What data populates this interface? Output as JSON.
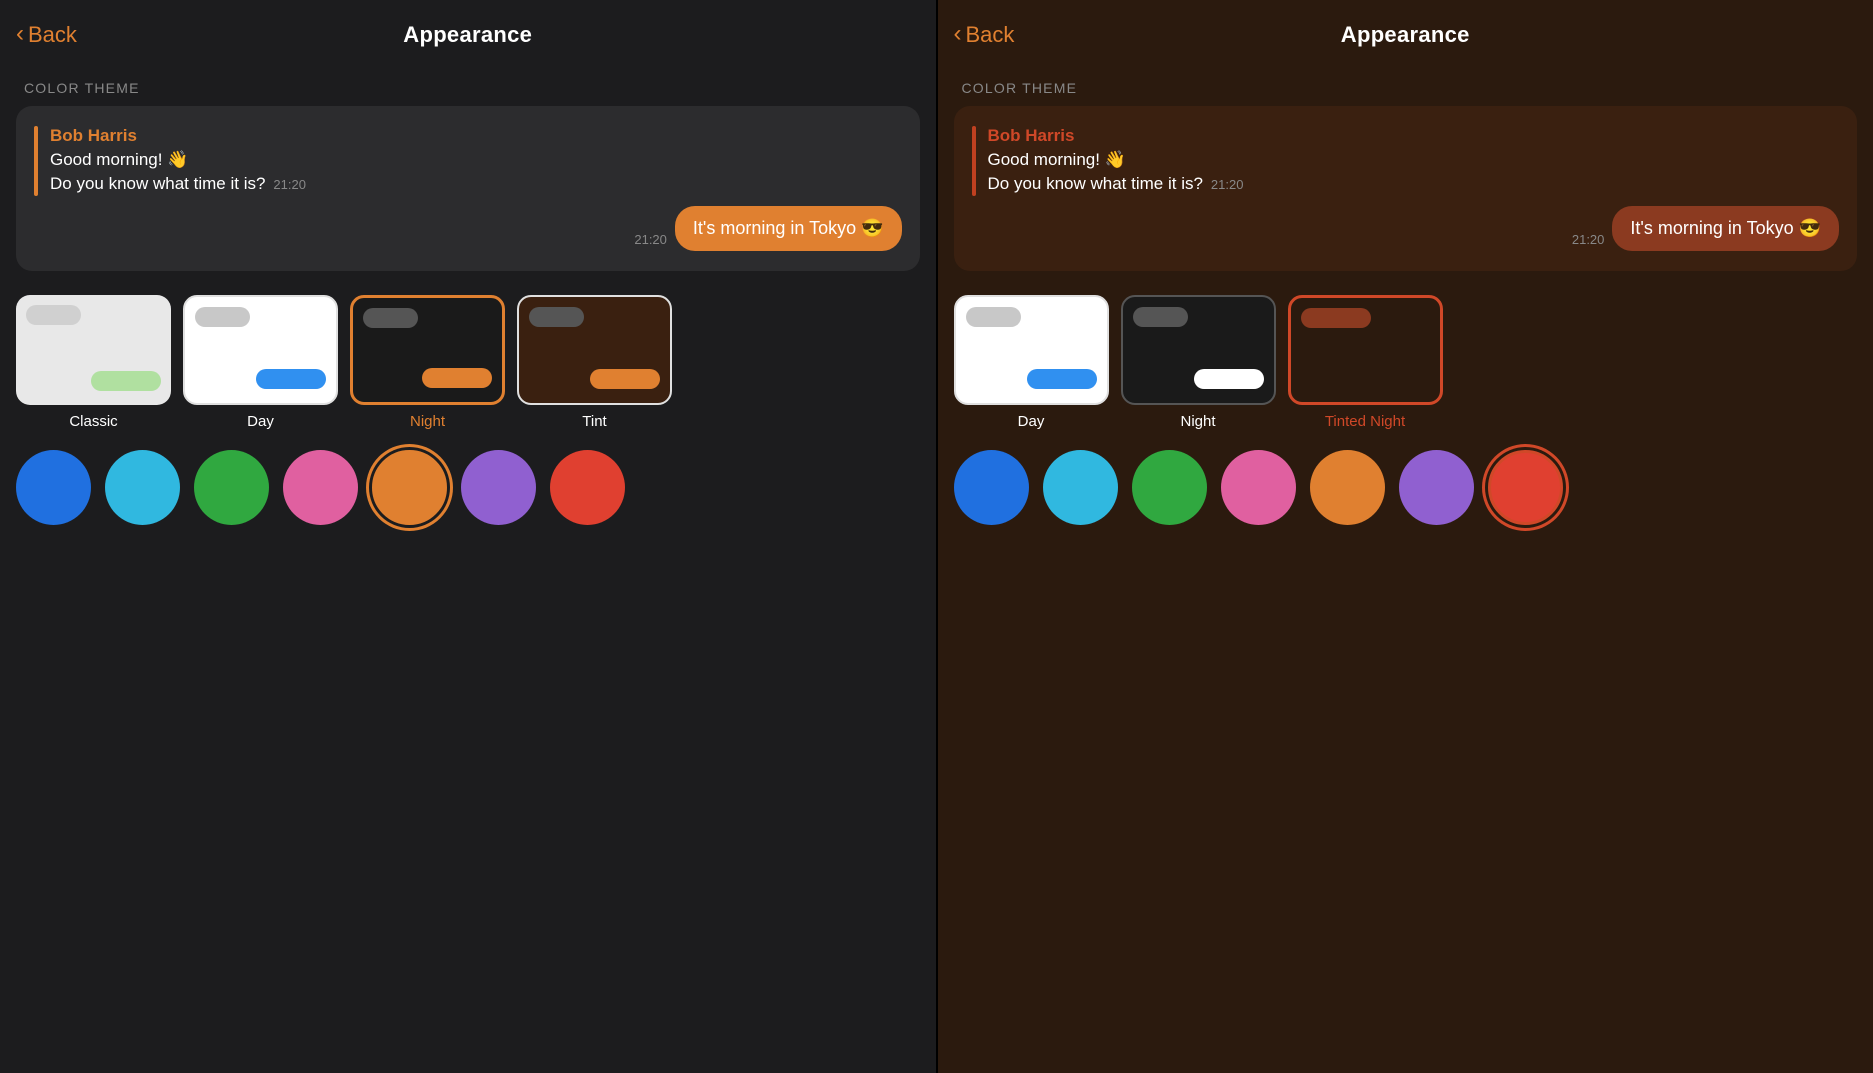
{
  "left_panel": {
    "back_label": "Back",
    "title": "Appearance",
    "section_label": "COLOR THEME",
    "chat": {
      "sender": "Bob Harris",
      "line1": "Good morning! 👋",
      "line2": "Do you know what time it is?",
      "time1": "21:20",
      "outgoing_message": "It's morning in Tokyo 😎",
      "outgoing_time": "21:20"
    },
    "themes": [
      {
        "id": "classic",
        "label": "Classic",
        "active": false
      },
      {
        "id": "day",
        "label": "Day",
        "active": false
      },
      {
        "id": "night",
        "label": "Night",
        "active": true
      },
      {
        "id": "tinted",
        "label": "Tint",
        "active": false
      }
    ],
    "colors": [
      {
        "hex": "#2070e0",
        "selected": false
      },
      {
        "hex": "#30b8e0",
        "selected": false
      },
      {
        "hex": "#30a840",
        "selected": false
      },
      {
        "hex": "#e060a0",
        "selected": false
      },
      {
        "hex": "#e08030",
        "selected": true
      },
      {
        "hex": "#9060d0",
        "selected": false
      },
      {
        "hex": "#e04030",
        "selected": false
      }
    ]
  },
  "right_panel": {
    "back_label": "Back",
    "title": "Appearance",
    "section_label": "COLOR THEME",
    "chat": {
      "sender": "Bob Harris",
      "line1": "Good morning! 👋",
      "line2": "Do you know what time it is?",
      "time1": "21:20",
      "outgoing_message": "It's morning in Tokyo 😎",
      "outgoing_time": "21:20"
    },
    "themes": [
      {
        "id": "day",
        "label": "Day",
        "active": false
      },
      {
        "id": "night",
        "label": "Night",
        "active": false
      },
      {
        "id": "tinted_night",
        "label": "Tinted Night",
        "active": true
      }
    ],
    "colors": [
      {
        "hex": "#2070e0",
        "selected": false
      },
      {
        "hex": "#30b8e0",
        "selected": false
      },
      {
        "hex": "#30a840",
        "selected": false
      },
      {
        "hex": "#e060a0",
        "selected": false
      },
      {
        "hex": "#e08030",
        "selected": false
      },
      {
        "hex": "#9060d0",
        "selected": false
      },
      {
        "hex": "#e04030",
        "selected": true
      }
    ]
  }
}
